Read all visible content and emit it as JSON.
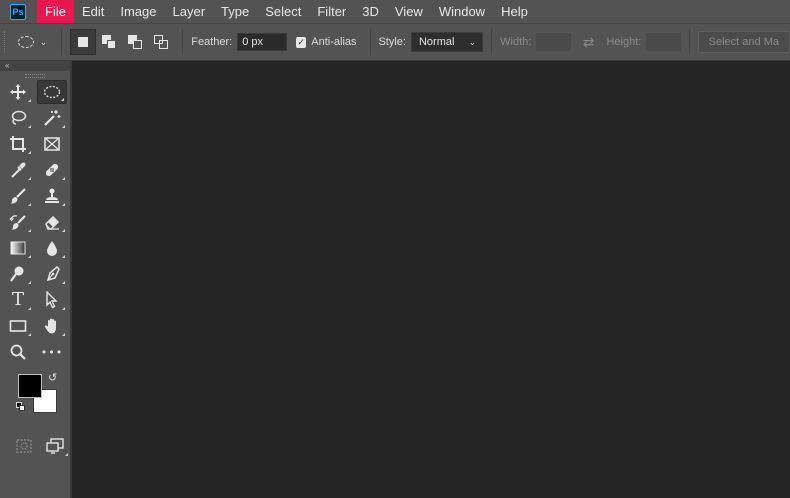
{
  "app": {
    "logo_text": "Ps"
  },
  "menu": {
    "items": [
      "File",
      "Edit",
      "Image",
      "Layer",
      "Type",
      "Select",
      "Filter",
      "3D",
      "View",
      "Window",
      "Help"
    ],
    "active": "File"
  },
  "options": {
    "feather_label": "Feather:",
    "feather_value": "0 px",
    "antialias_label": "Anti-alias",
    "antialias_checked": true,
    "style_label": "Style:",
    "style_value": "Normal",
    "width_label": "Width:",
    "width_value": "",
    "height_label": "Height:",
    "height_value": "",
    "select_mask_label": "Select and Ma"
  },
  "toolbar": {
    "collapse_label": "«",
    "tools": [
      {
        "name": "move-tool",
        "icon": "move-icon",
        "selected": false
      },
      {
        "name": "elliptical-marquee-tool",
        "icon": "ellipse-marquee-icon",
        "selected": true
      },
      {
        "name": "lasso-tool",
        "icon": "lasso-icon",
        "selected": false
      },
      {
        "name": "magic-wand-tool",
        "icon": "magic-wand-icon",
        "selected": false
      },
      {
        "name": "crop-tool",
        "icon": "crop-icon",
        "selected": false
      },
      {
        "name": "frame-tool",
        "icon": "frame-icon",
        "selected": false
      },
      {
        "name": "eyedropper-tool",
        "icon": "eyedropper-icon",
        "selected": false
      },
      {
        "name": "healing-brush-tool",
        "icon": "bandage-icon",
        "selected": false
      },
      {
        "name": "brush-tool",
        "icon": "brush-icon",
        "selected": false
      },
      {
        "name": "clone-stamp-tool",
        "icon": "stamp-icon",
        "selected": false
      },
      {
        "name": "history-brush-tool",
        "icon": "history-brush-icon",
        "selected": false
      },
      {
        "name": "eraser-tool",
        "icon": "eraser-icon",
        "selected": false
      },
      {
        "name": "gradient-tool",
        "icon": "gradient-icon",
        "selected": false
      },
      {
        "name": "blur-tool",
        "icon": "drop-icon",
        "selected": false
      },
      {
        "name": "dodge-tool",
        "icon": "dodge-icon",
        "selected": false
      },
      {
        "name": "pen-tool",
        "icon": "pen-icon",
        "selected": false
      },
      {
        "name": "type-tool",
        "icon": "type-icon",
        "glyph": "T",
        "selected": false
      },
      {
        "name": "path-selection-tool",
        "icon": "arrow-icon",
        "selected": false
      },
      {
        "name": "rectangle-tool",
        "icon": "rectangle-icon",
        "selected": false
      },
      {
        "name": "hand-tool",
        "icon": "hand-icon",
        "selected": false
      },
      {
        "name": "zoom-tool",
        "icon": "zoom-icon",
        "selected": false
      },
      {
        "name": "more-tools",
        "icon": "more-icon",
        "glyph": "•••",
        "selected": false
      }
    ]
  },
  "colors": {
    "foreground": "#000000",
    "background": "#ffffff",
    "accent": "#e8174f"
  }
}
